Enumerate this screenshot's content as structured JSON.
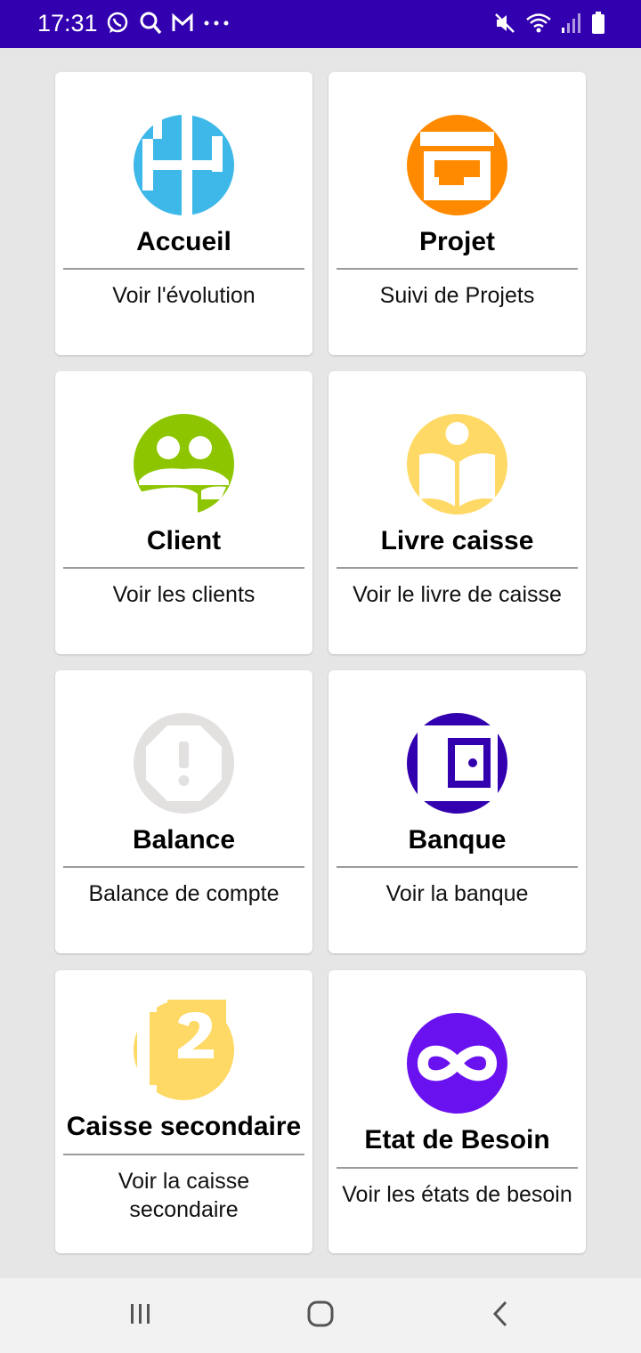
{
  "status_bar": {
    "time": "17:31",
    "left_icons": [
      "whatsapp-icon",
      "search-icon",
      "gmail-icon",
      "more-icon"
    ],
    "right_icons": [
      "mute-vibrate-icon",
      "wifi-icon",
      "signal-icon",
      "battery-icon"
    ]
  },
  "tiles": [
    {
      "title": "Accueil",
      "subtitle": "Voir l'évolution",
      "icon": "dashboard-icon",
      "color": "#3db8e8"
    },
    {
      "title": "Projet",
      "subtitle": "Suivi de Projets",
      "icon": "store-icon",
      "color": "#ff8a00"
    },
    {
      "title": "Client",
      "subtitle": "Voir les clients",
      "icon": "clients-icon",
      "color": "#8dc600"
    },
    {
      "title": "Livre caisse",
      "subtitle": "Voir le livre de caisse",
      "icon": "book-reader-icon",
      "color": "#ffd966"
    },
    {
      "title": "Balance",
      "subtitle": "Balance de compte",
      "icon": "alert-octagon-icon",
      "color": "#e3e0e0"
    },
    {
      "title": "Banque",
      "subtitle": "Voir la banque",
      "icon": "wallet-icon",
      "color": "#3300b0"
    },
    {
      "title": "Caisse secondaire",
      "subtitle": "Voir la caisse secondaire",
      "icon": "number-two-icon",
      "color": "#ffd966"
    },
    {
      "title": "Etat de Besoin",
      "subtitle": "Voir les états de besoin",
      "icon": "infinity-icon",
      "color": "#6a11f0"
    }
  ],
  "nav_bar": {
    "buttons": [
      "recent-apps-icon",
      "home-icon",
      "back-icon"
    ]
  }
}
